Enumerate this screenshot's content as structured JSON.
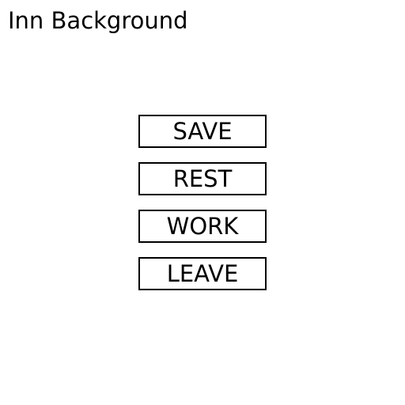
{
  "screen": {
    "title": "Inn Background"
  },
  "menu": {
    "items": [
      {
        "label": "SAVE"
      },
      {
        "label": "REST"
      },
      {
        "label": "WORK"
      },
      {
        "label": "LEAVE"
      }
    ]
  }
}
